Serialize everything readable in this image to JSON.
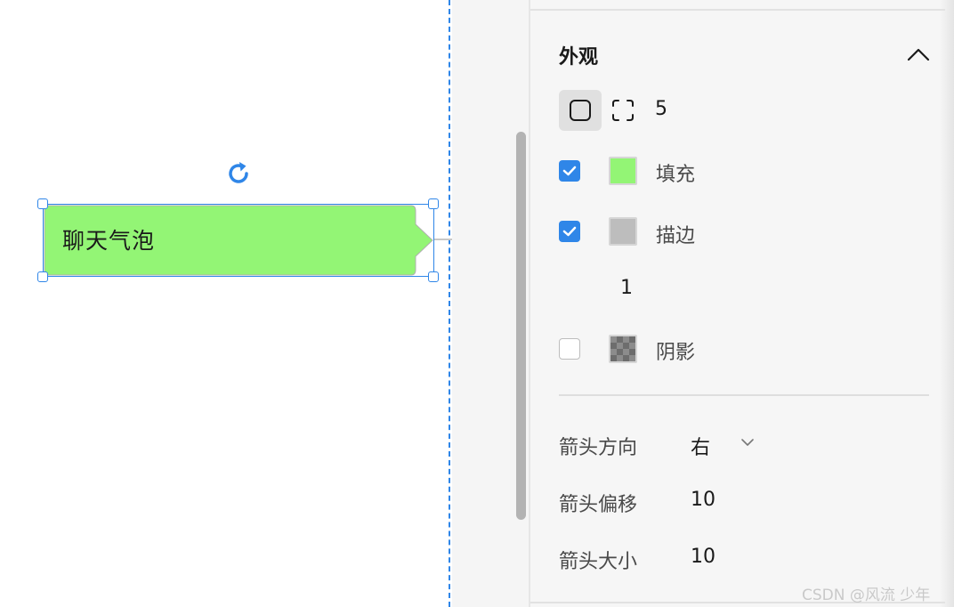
{
  "canvas": {
    "bubble_text": "聊天气泡",
    "bubble_fill": "#93f575",
    "selection_color": "#2f86e8"
  },
  "panel": {
    "section_title": "外观",
    "corner_radius": "5",
    "fill": {
      "label": "填充",
      "checked": true,
      "color": "#93f575"
    },
    "stroke": {
      "label": "描边",
      "checked": true,
      "color": "#bdbdbd",
      "width": "1"
    },
    "shadow": {
      "label": "阴影",
      "checked": false
    },
    "arrow_direction": {
      "label": "箭头方向",
      "value": "右"
    },
    "arrow_offset": {
      "label": "箭头偏移",
      "value": "10"
    },
    "arrow_size": {
      "label": "箭头大小",
      "value": "10"
    }
  },
  "watermark": "CSDN @风流 少年"
}
